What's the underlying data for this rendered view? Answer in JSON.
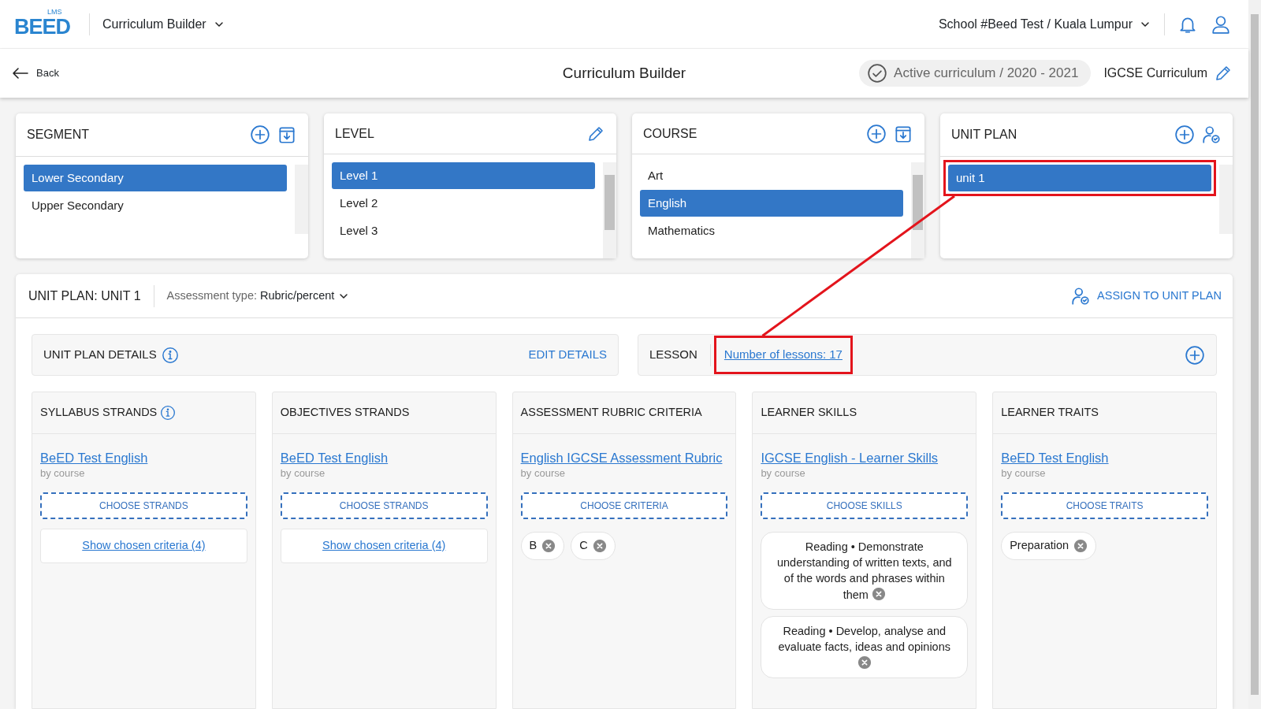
{
  "logo": {
    "mark": "BEED",
    "superscript": "LMS"
  },
  "app_menu": {
    "label": "Curriculum Builder"
  },
  "school_menu": {
    "label": "School #Beed Test / Kuala Lumpur"
  },
  "back": {
    "label": "Back"
  },
  "page_title": "Curriculum Builder",
  "status_chip": {
    "label": "Active curriculum / 2020 - 2021",
    "active": true
  },
  "curriculum_name": "IGCSE Curriculum",
  "selectors": [
    {
      "title": "SEGMENT",
      "actions": [
        {
          "kind": "add"
        },
        {
          "kind": "import"
        }
      ],
      "items": [
        {
          "label": "Lower Secondary",
          "selected": true,
          "highlighted": false
        },
        {
          "label": "Upper Secondary",
          "selected": false,
          "highlighted": false
        }
      ]
    },
    {
      "title": "LEVEL",
      "actions": [
        {
          "kind": "edit"
        }
      ],
      "items": [
        {
          "label": "Level 1",
          "selected": true,
          "highlighted": false
        },
        {
          "label": "Level 2",
          "selected": false,
          "highlighted": false
        },
        {
          "label": "Level 3",
          "selected": false,
          "highlighted": false
        }
      ]
    },
    {
      "title": "COURSE",
      "actions": [
        {
          "kind": "add"
        },
        {
          "kind": "import"
        }
      ],
      "items": [
        {
          "label": "Art",
          "selected": false,
          "highlighted": false
        },
        {
          "label": "English",
          "selected": true,
          "highlighted": false
        },
        {
          "label": "Mathematics",
          "selected": false,
          "highlighted": false
        }
      ]
    },
    {
      "title": "UNIT PLAN",
      "actions": [
        {
          "kind": "add"
        },
        {
          "kind": "assign"
        }
      ],
      "items": [
        {
          "label": "unit 1",
          "selected": true,
          "highlighted": true
        }
      ]
    }
  ],
  "unit_plan": {
    "title": "UNIT PLAN: UNIT 1",
    "assessment_label": "Assessment type:",
    "assessment_value": "Rubric/percent",
    "assign_button": "ASSIGN TO UNIT PLAN",
    "details": {
      "title": "UNIT PLAN DETAILS",
      "edit": "EDIT DETAILS"
    },
    "lesson": {
      "title": "LESSON",
      "count_link": "Number of lessons: 17",
      "highlighted": true
    },
    "columns": [
      {
        "title": "SYLLABUS STRANDS",
        "info": true,
        "source": "BeED Test English",
        "source_note": "by course",
        "choose_button": "CHOOSE STRANDS",
        "summary_link": "Show chosen criteria (4)"
      },
      {
        "title": "OBJECTIVES STRANDS",
        "info": false,
        "source": "BeED Test English",
        "source_note": "by course",
        "choose_button": "CHOOSE STRANDS",
        "summary_link": "Show chosen criteria (4)"
      },
      {
        "title": "ASSESSMENT RUBRIC CRITERIA",
        "info": false,
        "source": "English IGCSE Assessment Rubric",
        "source_note": "by course",
        "choose_button": "CHOOSE CRITERIA",
        "chips": [
          {
            "kind": "tag",
            "label": "B"
          },
          {
            "kind": "tag",
            "label": "C"
          }
        ]
      },
      {
        "title": "LEARNER SKILLS",
        "info": false,
        "source": "IGCSE English - Learner Skills",
        "source_note": "by course",
        "choose_button": "CHOOSE SKILLS",
        "chips": [
          {
            "kind": "statement",
            "label": "Reading • Demonstrate understanding of written texts, and of the words and phrases within them"
          },
          {
            "kind": "statement",
            "label": "Reading • Develop, analyse and evaluate facts, ideas and opinions"
          }
        ]
      },
      {
        "title": "LEARNER TRAITS",
        "info": false,
        "source": "BeED Test English",
        "source_note": "by course",
        "choose_button": "CHOOSE TRAITS",
        "chips": [
          {
            "kind": "tag",
            "label": "Preparation"
          }
        ]
      }
    ]
  }
}
